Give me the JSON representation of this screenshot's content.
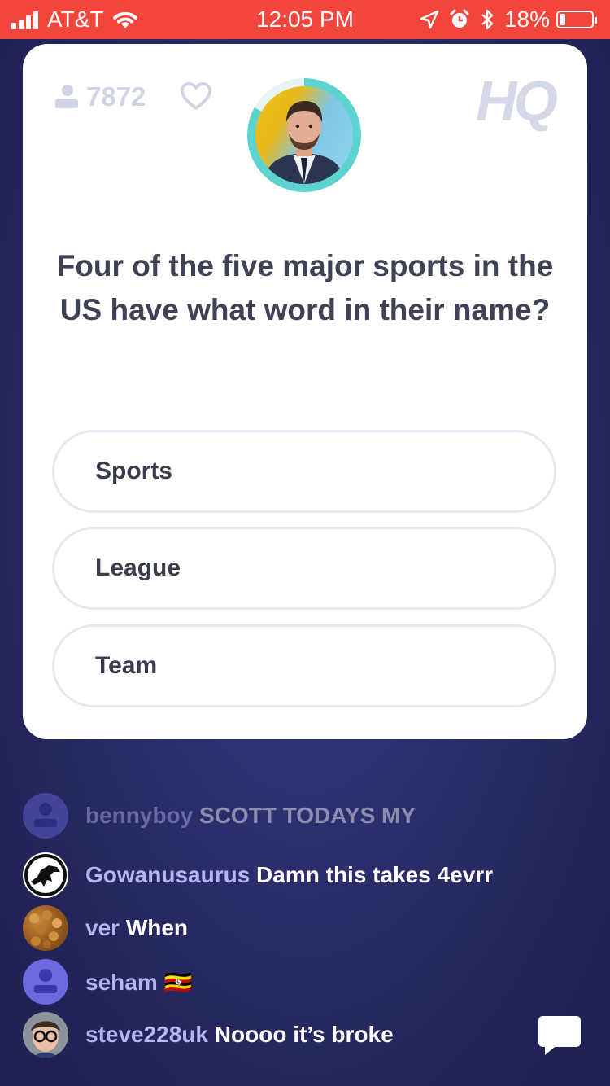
{
  "status_bar": {
    "carrier": "AT&T",
    "time": "12:05 PM",
    "battery": "18%",
    "battery_level": 0.18
  },
  "game": {
    "viewer_count": "7872",
    "logo": "HQ",
    "host_timer_progress": 0.83,
    "question": "Four of the five major sports in the US have what word in their name?",
    "answers": [
      "Sports",
      "League",
      "Team"
    ]
  },
  "chat": [
    {
      "user": "bennyboy",
      "message": "SCOTT TODAYS MY"
    },
    {
      "user": "Gowanusaurus",
      "message": "Damn this takes 4evrr"
    },
    {
      "user": "ver",
      "message": "When"
    },
    {
      "user": "seham",
      "message": "🇺🇬"
    },
    {
      "user": "steve228uk",
      "message": "Noooo it’s broke"
    }
  ],
  "colors": {
    "status_bar": "#f2453b",
    "background": "#2c2f6e",
    "timer_ring": "#5dd3cf",
    "chat_username": "#b7b4f3"
  },
  "icons": [
    "signal-bars-icon",
    "wifi-icon",
    "location-arrow-icon",
    "alarm-icon",
    "bluetooth-icon",
    "battery-icon",
    "person-icon",
    "heart-icon",
    "chat-bubble-icon"
  ]
}
